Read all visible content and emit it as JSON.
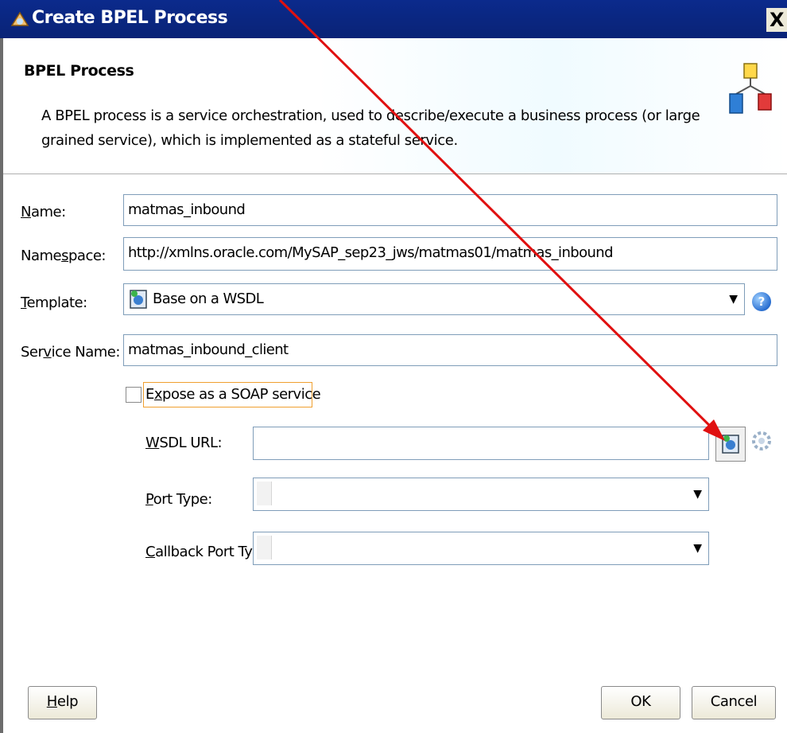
{
  "window": {
    "title": "Create BPEL Process",
    "close_label": "X"
  },
  "header": {
    "title": "BPEL Process",
    "description": "A BPEL process is a service orchestration, used to describe/execute a business process (or large grained service), which is implemented as a stateful service."
  },
  "form": {
    "name_label": "Name:",
    "name_value": "matmas_inbound",
    "namespace_label": "Namespace:",
    "namespace_value": "http://xmlns.oracle.com/MySAP_sep23_jws/matmas01/matmas_inbound",
    "template_label": "Template:",
    "template_value": "Base on a WSDL",
    "service_name_label": "Service Name:",
    "service_name_value": "matmas_inbound_client",
    "expose_soap_label": "Expose as a SOAP service",
    "expose_soap_checked": false,
    "wsdl_url_label": "WSDL URL:",
    "wsdl_url_value": "",
    "port_type_label": "Port Type:",
    "port_type_value": "",
    "callback_port_type_label": "Callback Port Type:",
    "callback_port_type_value": ""
  },
  "buttons": {
    "help": "Help",
    "ok": "OK",
    "cancel": "Cancel"
  },
  "icons": {
    "title": "bpel-process-icon",
    "header": "bpel-diagram-icon",
    "template": "wsdl-icon",
    "help": "help-icon",
    "browse": "browse-wsdl-icon",
    "service_explorer": "gear-icon",
    "annotation": "red-arrow-annotation"
  },
  "colors": {
    "titlebar": "#0b2a8c",
    "annotation_arrow": "#e01010",
    "focus_border": "#f0a030"
  }
}
